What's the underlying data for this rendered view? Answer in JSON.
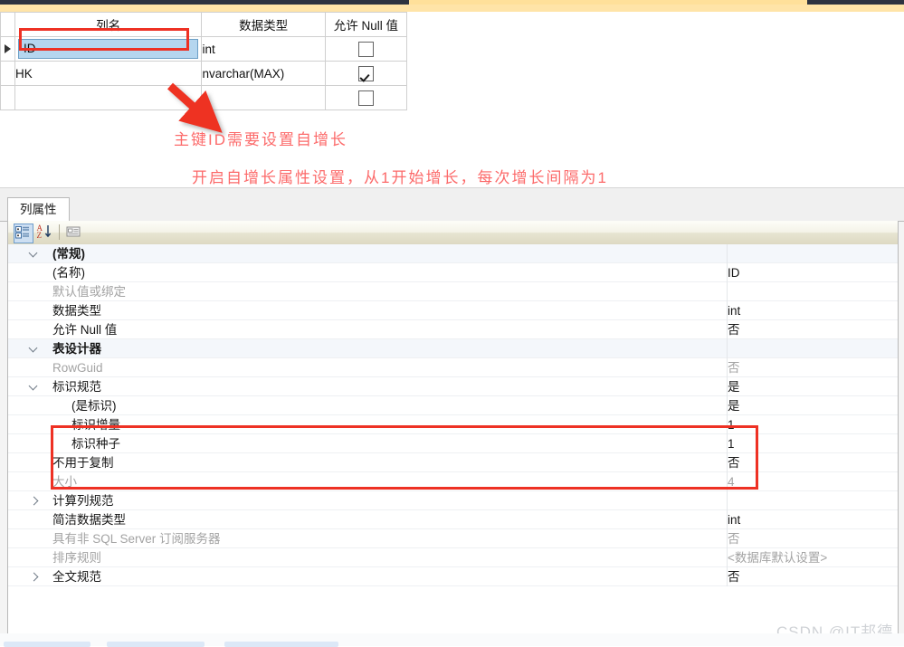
{
  "designer_grid": {
    "columns": [
      "列名",
      "数据类型",
      "允许 Null 值"
    ],
    "rows": [
      {
        "selected": true,
        "name": "ID",
        "type": "int",
        "allow_null": false
      },
      {
        "selected": false,
        "name": "HK",
        "type": "nvarchar(MAX)",
        "allow_null": true
      },
      {
        "selected": false,
        "name": "",
        "type": "",
        "allow_null": false
      }
    ]
  },
  "annotations": {
    "line1": "主键ID需要设置自增长",
    "line2": "开启自增长属性设置，从1开始增长，每次增长间隔为1",
    "accent_color": "#fc6a6a",
    "highlight_color": "#ee3124"
  },
  "properties_pane": {
    "tab_label": "列属性",
    "toolbar": {
      "categorized_icon": "categorized-view-icon",
      "alphabetical_icon": "alphabetical-sort-icon",
      "property_pages_icon": "property-pages-icon"
    },
    "rows": [
      {
        "level": 0,
        "twisty": "down",
        "label": "(常规)",
        "value": "",
        "dim": false
      },
      {
        "level": 1,
        "twisty": "none",
        "label": "(名称)",
        "value": "ID",
        "dim": false
      },
      {
        "level": 1,
        "twisty": "none",
        "label": "默认值或绑定",
        "value": "",
        "dim": true
      },
      {
        "level": 1,
        "twisty": "none",
        "label": "数据类型",
        "value": "int",
        "dim": false
      },
      {
        "level": 1,
        "twisty": "none",
        "label": "允许 Null 值",
        "value": "否",
        "dim": false
      },
      {
        "level": 0,
        "twisty": "down",
        "label": "表设计器",
        "value": "",
        "dim": false
      },
      {
        "level": 1,
        "twisty": "none",
        "label": "RowGuid",
        "value": "否",
        "dim": true
      },
      {
        "level": 1,
        "twisty": "down",
        "label": "标识规范",
        "value": "是",
        "dim": false
      },
      {
        "level": 2,
        "twisty": "none",
        "label": "(是标识)",
        "value": "是",
        "dim": false
      },
      {
        "level": 2,
        "twisty": "none",
        "label": "标识增量",
        "value": "1",
        "dim": false
      },
      {
        "level": 2,
        "twisty": "none",
        "label": "标识种子",
        "value": "1",
        "dim": false
      },
      {
        "level": 1,
        "twisty": "none",
        "label": "不用于复制",
        "value": "否",
        "dim": false
      },
      {
        "level": 1,
        "twisty": "none",
        "label": "大小",
        "value": "4",
        "dim": true
      },
      {
        "level": 1,
        "twisty": "right",
        "label": "计算列规范",
        "value": "",
        "dim": false
      },
      {
        "level": 1,
        "twisty": "none",
        "label": "简洁数据类型",
        "value": "int",
        "dim": false
      },
      {
        "level": 1,
        "twisty": "none",
        "label": "具有非 SQL Server 订阅服务器",
        "value": "否",
        "dim": true
      },
      {
        "level": 1,
        "twisty": "none",
        "label": "排序规则",
        "value": "<数据库默认设置>",
        "dim": true
      },
      {
        "level": 1,
        "twisty": "right",
        "label": "全文规范",
        "value": "否",
        "dim": false
      }
    ]
  },
  "watermark": "CSDN @IT邦德"
}
